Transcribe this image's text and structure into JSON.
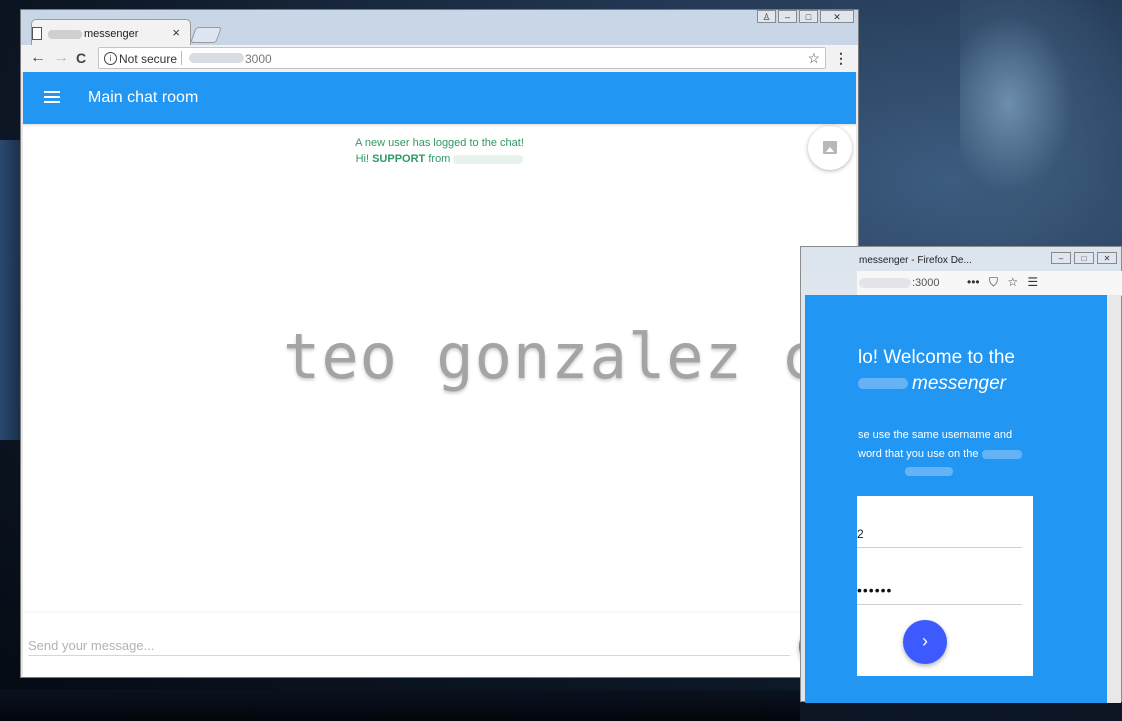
{
  "chrome": {
    "tab_title": "messenger",
    "tab_close": "×",
    "not_secure": "Not secure",
    "url_port": "3000",
    "star": "☆",
    "menu": "⋮",
    "nav_back": "←",
    "nav_forward": "→",
    "nav_reload": "C",
    "win_min": "–",
    "win_max": "□",
    "win_close": "✕"
  },
  "app": {
    "title": "Main chat room",
    "system_msg_line1": "A new user has logged to the chat!",
    "system_msg_hi": "Hi!",
    "system_msg_user": "SUPPORT",
    "system_msg_from": "from",
    "watermark": "teo gonzalez c.",
    "message_placeholder": "Send your message..."
  },
  "firefox": {
    "title": "messenger - Firefox De...",
    "url_port": ":3000",
    "icon_more": "•••",
    "icon_pocket": "⛉",
    "icon_star": "☆",
    "icon_menu": "☰",
    "welcome_line1": "lo! Welcome to the",
    "welcome_line2": "messenger",
    "note_line1": "se use the same username and",
    "note_line2": "word that you use on the",
    "username_value": "2",
    "password_value": "••••••",
    "go": "›"
  },
  "colors": {
    "appbar": "#2196f3",
    "send_fab": "#536dfe",
    "system_text": "#2e9a62"
  }
}
